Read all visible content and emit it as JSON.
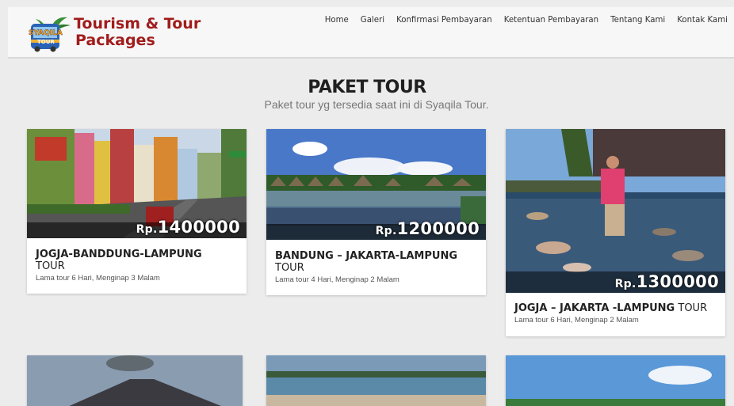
{
  "header": {
    "logo_line1": "Tourism & Tour",
    "logo_line2": "Packages",
    "badge_line1": "SYAQILA",
    "badge_line2": "TOUR"
  },
  "nav": [
    "Home",
    "Galeri",
    "Konfirmasi Pembayaran",
    "Ketentuan Pembayaran",
    "Tentang Kami",
    "Kontak Kami"
  ],
  "main": {
    "title": "PAKET TOUR",
    "subtitle": "Paket tour yg tersedia saat ini di Syaqila Tour."
  },
  "packages": [
    {
      "title": "JOGJA-BANDDUNG-LAMPUNG",
      "suffix": "TOUR",
      "currency": "Rp.",
      "price": "1400000",
      "desc": "Lama tour 6 Hari, Menginap 3 Malam"
    },
    {
      "title": "BANDUNG – JAKARTA-LAMPUNG",
      "suffix": "TOUR",
      "currency": "Rp.",
      "price": "1200000",
      "desc": "Lama tour 4 Hari, Menginap 2 Malam"
    },
    {
      "title": "JOGJA – JAKARTA -LAMPUNG",
      "suffix": "TOUR",
      "currency": "Rp.",
      "price": "1300000",
      "desc": "Lama tour 6 Hari, Menginap 2 Malam"
    }
  ],
  "colors": {
    "brand": "#a11c1c",
    "background": "#ececec"
  },
  "icons": [
    "logo-badge-icon"
  ]
}
